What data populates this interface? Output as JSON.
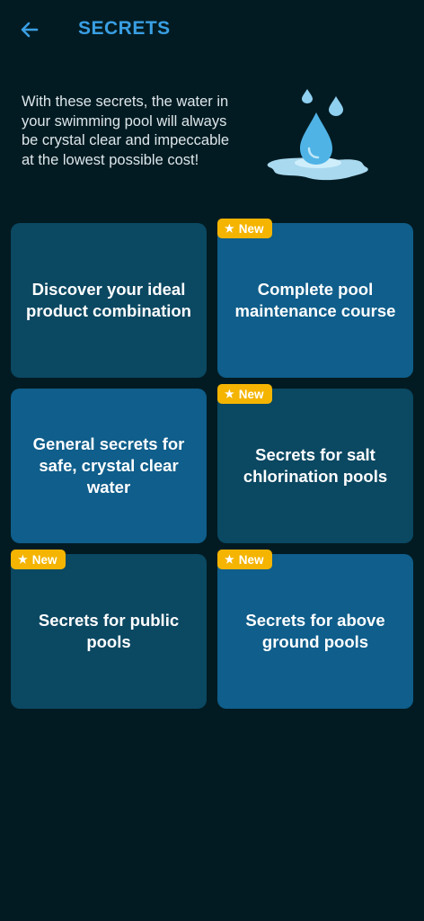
{
  "header": {
    "title": "SECRETS",
    "back_icon": "arrow-left-icon"
  },
  "intro": {
    "text": "With these secrets, the water in your swimming pool will always be crystal clear and impeccable at the lowest possible cost!",
    "illustration_icon": "water-drop-icon"
  },
  "colors": {
    "background": "#021b22",
    "accent": "#3a9fe3",
    "card_light": "#0f5e8b",
    "card_dark": "#0b4862",
    "badge": "#f4b400"
  },
  "cards": [
    {
      "title": "Discover your ideal product combination",
      "badge": ""
    },
    {
      "title": "Complete pool maintenance course",
      "badge": "New"
    },
    {
      "title": "General secrets for safe, crystal clear water",
      "badge": ""
    },
    {
      "title": "Secrets for salt chlorination pools",
      "badge": "New"
    },
    {
      "title": "Secrets for public pools",
      "badge": "New"
    },
    {
      "title": "Secrets for above ground pools",
      "badge": "New"
    }
  ]
}
